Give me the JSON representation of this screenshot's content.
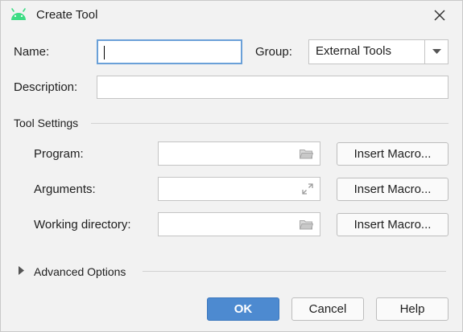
{
  "window": {
    "title": "Create Tool",
    "icon": "android-icon",
    "close_icon": "close-icon"
  },
  "form": {
    "name_label": "Name:",
    "name_value": "",
    "group_label": "Group:",
    "group_value": "External Tools",
    "description_label": "Description:",
    "description_value": ""
  },
  "tool_settings": {
    "section_title": "Tool Settings",
    "program_label": "Program:",
    "program_value": "",
    "arguments_label": "Arguments:",
    "arguments_value": "",
    "working_dir_label": "Working directory:",
    "working_dir_value": "",
    "insert_macro_label": "Insert Macro..."
  },
  "advanced": {
    "section_title": "Advanced Options",
    "expanded": false
  },
  "buttons": {
    "ok": "OK",
    "cancel": "Cancel",
    "help": "Help"
  },
  "colors": {
    "accent": "#4d8ad0",
    "focus": "#6aa0d8",
    "android_green": "#3ddc84"
  }
}
